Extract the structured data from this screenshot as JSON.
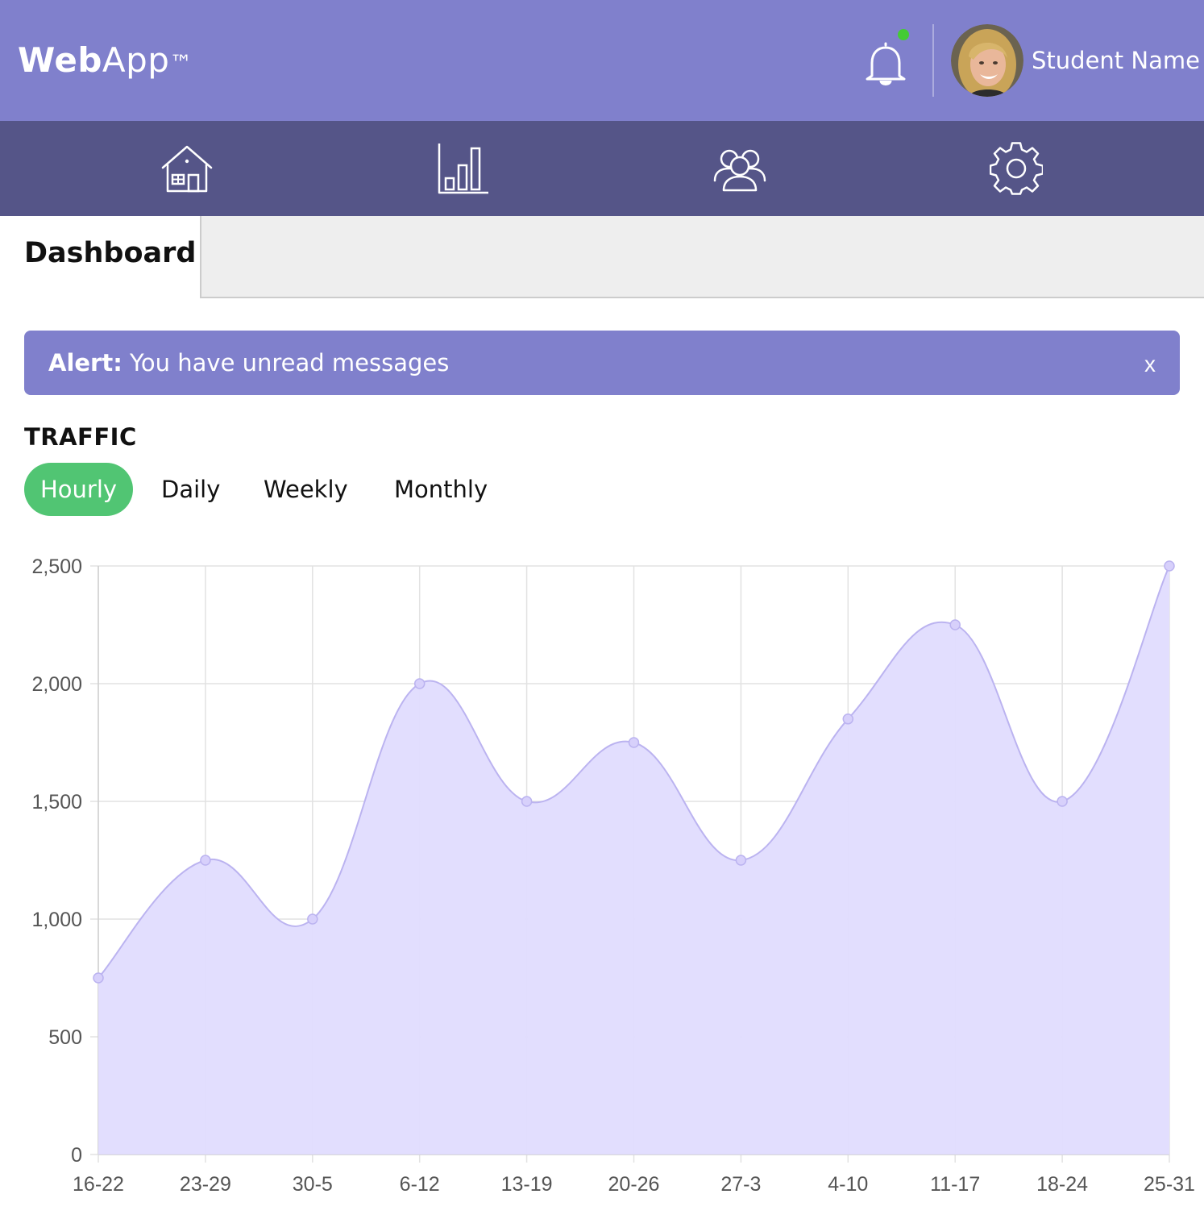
{
  "header": {
    "logo_bold": "Web",
    "logo_light": "App",
    "logo_tm": "™",
    "user_name": "Student Name",
    "notification_active": true,
    "colors": {
      "header_bg": "#8080cc",
      "nav_bg": "#555588",
      "notification_dot": "#44cc33"
    }
  },
  "nav": {
    "items": [
      {
        "icon": "home-icon"
      },
      {
        "icon": "bar-chart-icon"
      },
      {
        "icon": "users-icon"
      },
      {
        "icon": "gear-icon"
      }
    ]
  },
  "page": {
    "title": "Dashboard"
  },
  "alert": {
    "label": "Alert:",
    "message": "You have unread messages",
    "close": "x"
  },
  "traffic": {
    "heading": "TRAFFIC",
    "tabs": [
      "Hourly",
      "Daily",
      "Weekly",
      "Monthly"
    ],
    "active_tab": "Hourly",
    "active_color": "#51c573"
  },
  "chart_data": {
    "type": "area",
    "categories": [
      "16-22",
      "23-29",
      "30-5",
      "6-12",
      "13-19",
      "20-26",
      "27-3",
      "4-10",
      "11-17",
      "18-24",
      "25-31"
    ],
    "values": [
      750,
      1250,
      1000,
      2000,
      1500,
      1750,
      1250,
      1850,
      2250,
      1500,
      2500
    ],
    "yticks": [
      "0",
      "500",
      "1,000",
      "1,500",
      "2,000",
      "2,500"
    ],
    "ylim": [
      0,
      2500
    ],
    "grid": true,
    "fill_color": "#e0dcfe",
    "line_color": "#bbb3f0"
  }
}
